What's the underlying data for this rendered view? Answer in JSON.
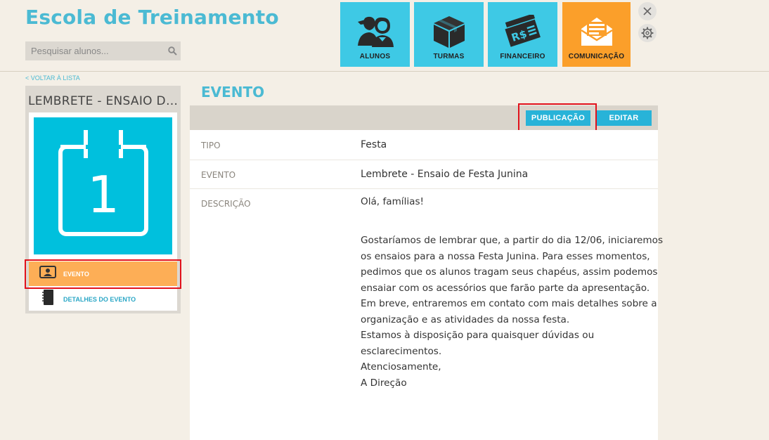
{
  "header": {
    "app_title": "Escola de Treinamento",
    "search_placeholder": "Pesquisar alunos...",
    "nav": [
      {
        "label": "ALUNOS",
        "icon": "students-icon",
        "active": false
      },
      {
        "label": "TURMAS",
        "icon": "box-icon",
        "active": false
      },
      {
        "label": "FINANCEIRO",
        "icon": "money-icon",
        "active": false
      },
      {
        "label": "COMUNICAÇÃO",
        "icon": "envelope-icon",
        "active": true
      }
    ]
  },
  "colors": {
    "accent": "#4bbad3",
    "tile": "#3ec9e5",
    "tile_active": "#fb9f2a",
    "sidebar_active": "#fdae56",
    "button": "#28b3d8",
    "highlight": "#e1121c"
  },
  "back_link": "< VOLTAR À LISTA",
  "sidebar": {
    "title": "LEMBRETE - ENSAIO DE FESTA JUNINA",
    "calendar_day": "1",
    "items": [
      {
        "label": "EVENTO",
        "icon": "person-card-icon",
        "active": true
      },
      {
        "label": "DETALHES DO EVENTO",
        "icon": "notebook-icon",
        "active": false
      }
    ]
  },
  "main": {
    "title": "EVENTO",
    "buttons": {
      "publish": "PUBLICAÇÃO",
      "edit": "EDITAR"
    },
    "fields": [
      {
        "label": "TIPO",
        "value": "Festa"
      },
      {
        "label": "EVENTO",
        "value": "Lembrete - Ensaio de Festa Junina"
      },
      {
        "label": "DESCRIÇÃO"
      }
    ],
    "description": [
      "Olá, famílias!",
      "",
      "",
      "Gostaríamos de lembrar que, a partir do dia 12/06, iniciaremos",
      "os ensaios para a nossa Festa Junina. Para esses momentos,",
      "pedimos que os alunos tragam seus chapéus, assim podemos",
      "ensaiar com os acessórios que farão parte da apresentação.",
      "Em breve, entraremos em contato com mais detalhes sobre a",
      "organização e as atividades da nossa festa.",
      "Estamos à disposição para quaisquer dúvidas ou",
      "esclarecimentos.",
      "Atenciosamente,",
      "A Direção"
    ]
  }
}
